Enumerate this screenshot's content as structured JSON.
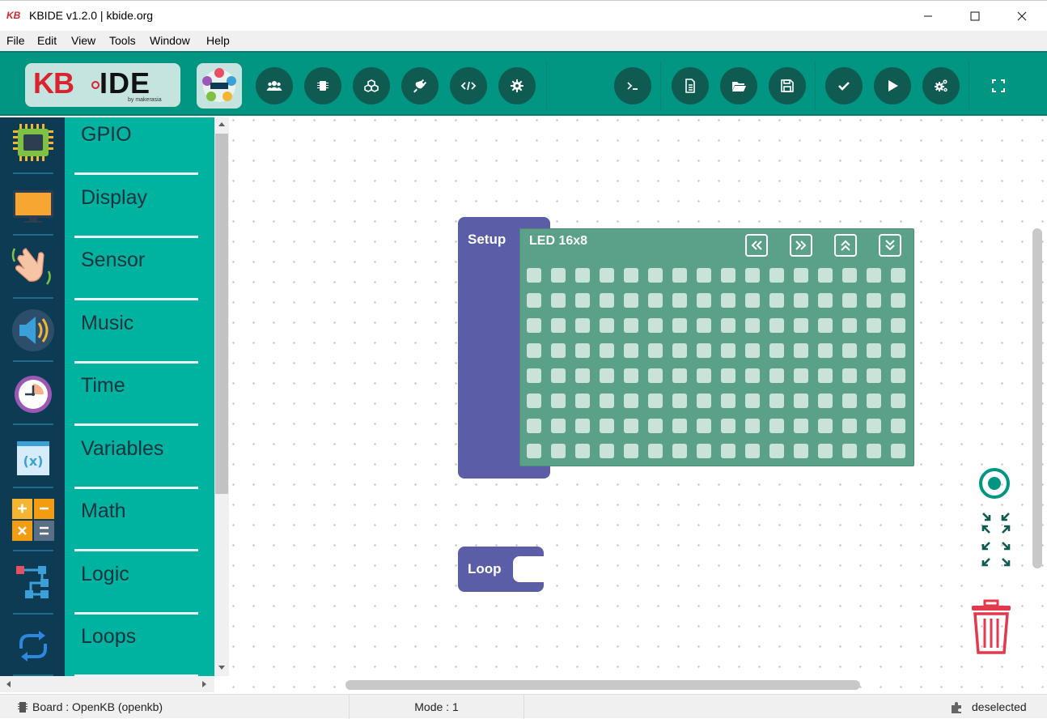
{
  "window": {
    "app_icon": "KB",
    "title": "KBIDE v1.2.0 | kbide.org",
    "buttons": [
      "minimize",
      "maximize",
      "close"
    ]
  },
  "menu": [
    "File",
    "Edit",
    "View",
    "Tools",
    "Window",
    "Help"
  ],
  "toolbar": {
    "logo_kb": "KB",
    "logo_ide": "IDE",
    "logo_by": "by makerasia",
    "left_buttons": [
      "users-icon",
      "board-icon",
      "plugins-icon",
      "plug-icon",
      "code-icon",
      "gear-icon"
    ],
    "right_buttons": [
      "terminal-icon",
      "new-file-icon",
      "open-folder-icon",
      "save-icon",
      "check-icon",
      "play-icon",
      "settings-gears-icon",
      "fullscreen-icon"
    ]
  },
  "categories": [
    {
      "label": "GPIO",
      "icon": "chip-icon"
    },
    {
      "label": "Display",
      "icon": "display-icon"
    },
    {
      "label": "Sensor",
      "icon": "hand-wave-icon"
    },
    {
      "label": "Music",
      "icon": "speaker-icon"
    },
    {
      "label": "Time",
      "icon": "clock-icon"
    },
    {
      "label": "Variables",
      "icon": "variables-icon"
    },
    {
      "label": "Math",
      "icon": "calculator-icon"
    },
    {
      "label": "Logic",
      "icon": "logic-icon"
    },
    {
      "label": "Loops",
      "icon": "loop-icon"
    }
  ],
  "workspace": {
    "setup_label": "Setup",
    "led_block_label": "LED 16x8",
    "led_columns": 16,
    "led_rows": 8,
    "loop_label": "Loop"
  },
  "status": {
    "board": "Board : OpenKB (openkb)",
    "mode": "Mode : 1",
    "selection": "deselected"
  },
  "colors": {
    "toolbar": "#009682",
    "toolbar_button": "#0f5b52",
    "sidebar_icons": "#0e3b54",
    "sidebar_labels": "#00b2a0",
    "setup_block": "#5b5ea6",
    "led_block": "#5ba18a",
    "trash": "#e3394d"
  }
}
